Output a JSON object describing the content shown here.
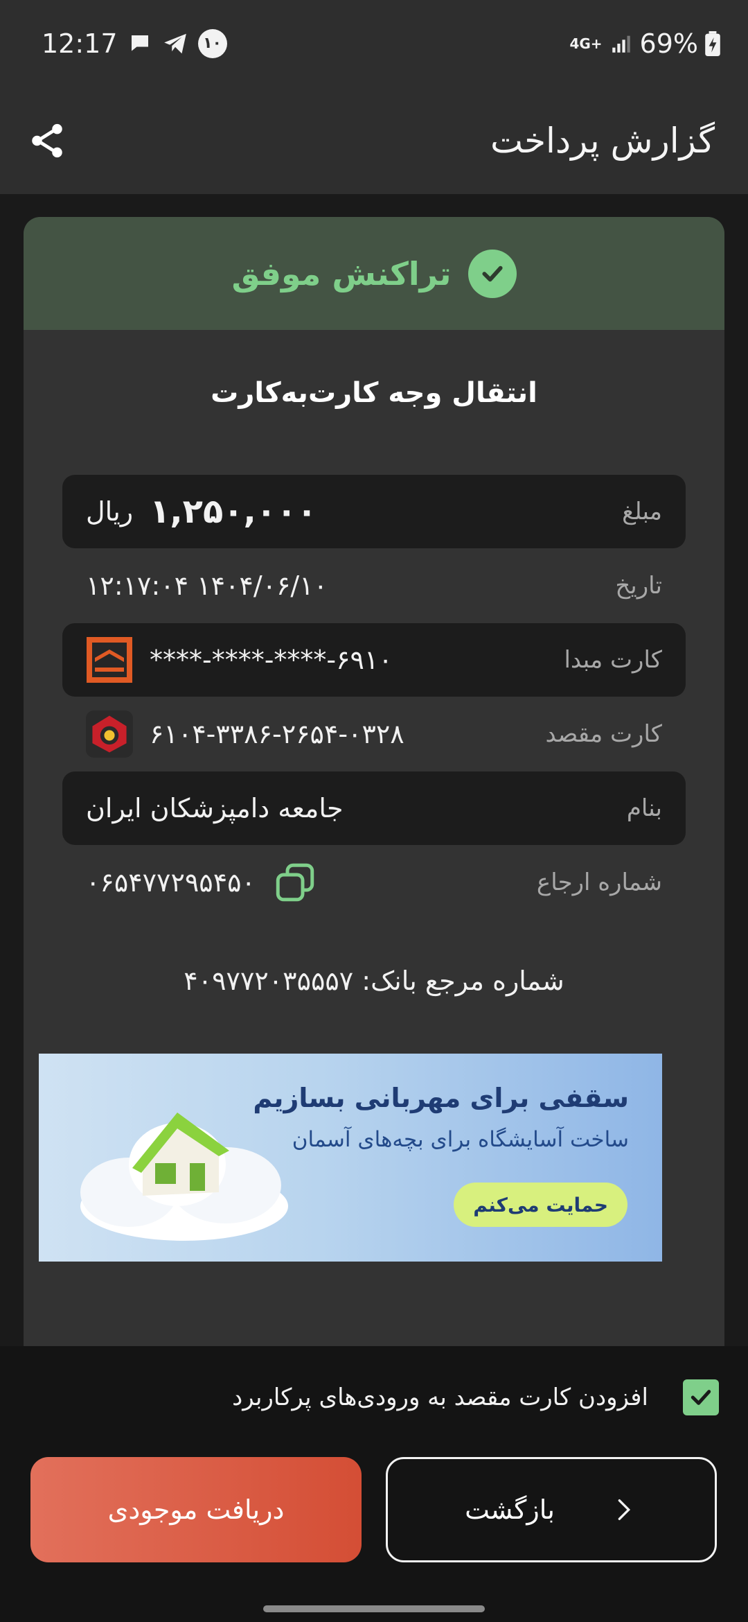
{
  "status_bar": {
    "time": "12:17",
    "notif_count": "۱۰",
    "network": "4G+",
    "battery": "69%"
  },
  "app_bar": {
    "title": "گزارش پرداخت"
  },
  "receipt": {
    "status": "تراکنش موفق",
    "title": "انتقال وجه کارت‌به‌کارت",
    "rows": [
      {
        "label": "مبلغ",
        "amount": "۱,۲۵۰,۰۰۰",
        "unit": "ریال"
      },
      {
        "label": "تاریخ",
        "value": "۱۴۰۴/۰۶/۱۰ ۱۲:۱۷:۰۴"
      },
      {
        "label": "کارت مبدا",
        "value": "****-****-****-۶۹۱۰"
      },
      {
        "label": "کارت مقصد",
        "value": "۶۱۰۴-۳۳۸۶-۲۶۵۴-۰۳۲۸"
      },
      {
        "label": "بنام",
        "value": "جامعه دامپزشکان ایران"
      },
      {
        "label": "شماره ارجاع",
        "value": "۰۶۵۴۷۷۲۹۵۴۵۰"
      }
    ],
    "bank_reference": "شماره مرجع بانک: ۴۰۹۷۷۲۰۳۵۵۵۷"
  },
  "banner": {
    "title": "سقفی برای مهربانی بسازیم",
    "subtitle": "ساخت آسایشگاه برای بچه‌های آسمان",
    "button": "حمایت می‌کنم"
  },
  "bottom": {
    "checkbox_label": "افزودن کارت مقصد به ورودی‌های پرکاربرد",
    "primary_button": "دریافت موجودی",
    "secondary_button": "بازگشت"
  },
  "colors": {
    "success_green": "#7fcf8a",
    "success_header_bg": "#445444",
    "primary_button": "#d95a40",
    "card_bg": "#333333",
    "row_dark_bg": "#1c1c1c"
  }
}
